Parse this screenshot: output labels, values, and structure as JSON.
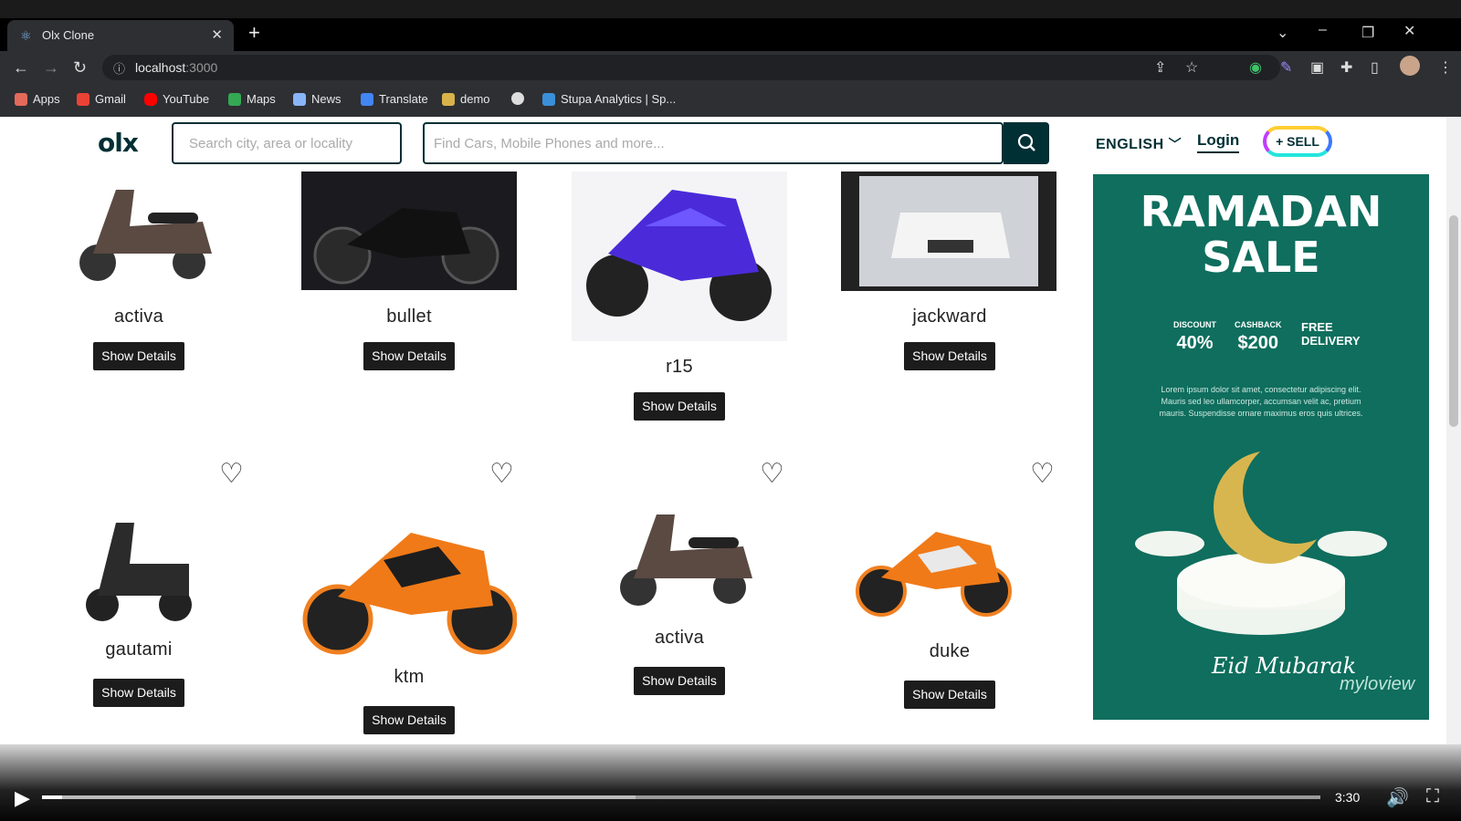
{
  "browser": {
    "tab_title": "Olx Clone",
    "url": "localhost",
    "url_port": ":3000",
    "bookmarks": [
      "Apps",
      "Gmail",
      "YouTube",
      "Maps",
      "News",
      "Translate",
      "demo",
      "",
      "Stupa Analytics | Sp..."
    ]
  },
  "header": {
    "logo": "olx",
    "location_placeholder": "Search city, area or locality",
    "search_placeholder": "Find Cars, Mobile Phones and more...",
    "language": "ENGLISH",
    "login": "Login",
    "sell": "+ SELL"
  },
  "products": [
    {
      "name": "activa",
      "button": "Show Details"
    },
    {
      "name": "bullet",
      "button": "Show Details"
    },
    {
      "name": "r15",
      "button": "Show Details"
    },
    {
      "name": "jackward",
      "button": "Show Details"
    },
    {
      "name": "gautami",
      "button": "Show Details"
    },
    {
      "name": "ktm",
      "button": "Show Details"
    },
    {
      "name": "activa",
      "button": "Show Details"
    },
    {
      "name": "duke",
      "button": "Show Details"
    }
  ],
  "ad": {
    "title_line1": "RAMADAN",
    "title_line2": "SALE",
    "discount_label": "DISCOUNT",
    "discount_value": "40%",
    "cashback_label": "CASHBACK",
    "cashback_value": "$200",
    "free_delivery_1": "FREE",
    "free_delivery_2": "DELIVERY",
    "lorem": "Lorem ipsum dolor sit amet, consectetur adipiscing elit. Mauris sed leo ullamcorper, accumsan velit ac, pretium mauris. Suspendisse ornare maximus eros quis ultrices.",
    "eid": "Eid Mubarak",
    "brand": "myloview"
  },
  "video": {
    "time": "3:30",
    "progress": 0.016
  }
}
